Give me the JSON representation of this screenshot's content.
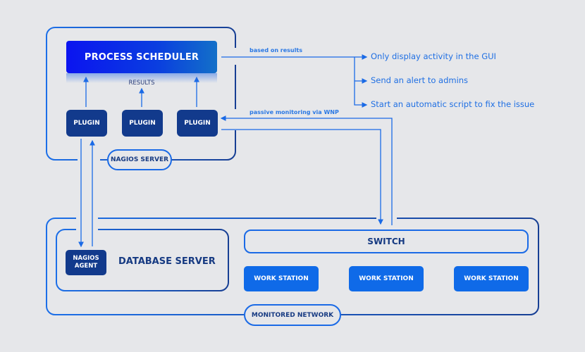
{
  "nagios_server": {
    "label": "NAGIOS SERVER",
    "scheduler": "PROCESS SCHEDULER",
    "results_label": "RESULTS",
    "plugins": [
      "PLUGIN",
      "PLUGIN",
      "PLUGIN"
    ]
  },
  "connectors": {
    "based_on_results": "based on results",
    "passive_monitoring": "passive monitoring via WNP"
  },
  "actions": [
    "Only display activity in the GUI",
    "Send an alert to admins",
    "Start an automatic script to fix the issue"
  ],
  "monitored_network": {
    "label": "MONITORED NETWORK",
    "database_server": {
      "title": "DATABASE SERVER",
      "agent_line1": "NAGIOS",
      "agent_line2": "AGENT"
    },
    "switch": "SWITCH",
    "workstations": [
      "WORK STATION",
      "WORK STATION",
      "WORK STATION"
    ]
  },
  "colors": {
    "background": "#e6e7ea",
    "dark_blue": "#123a8c",
    "accent_blue": "#1a6ae6",
    "workstation_blue": "#0f6ae8"
  }
}
